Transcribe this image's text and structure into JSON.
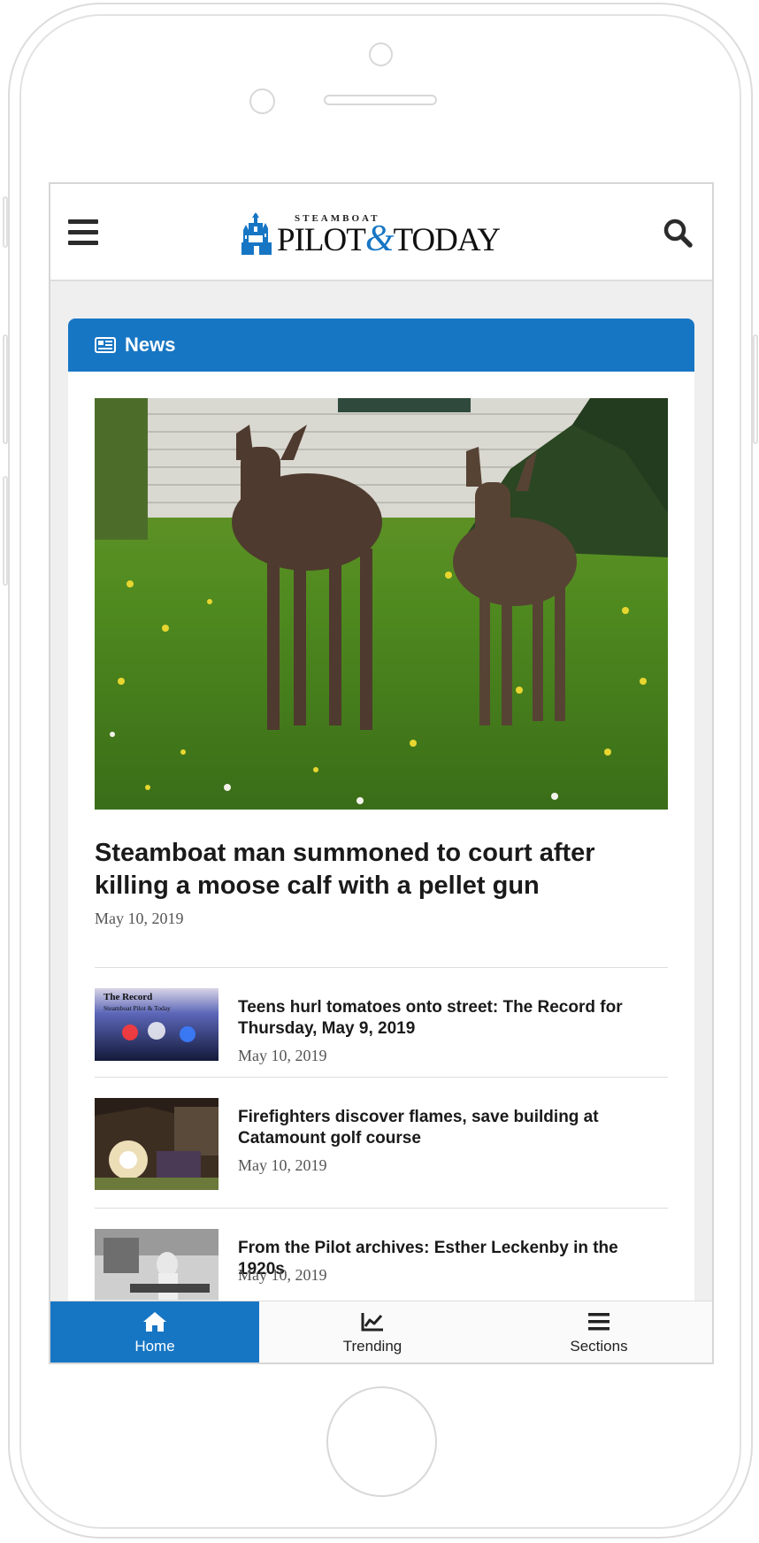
{
  "header": {
    "logo_small": "STEAMBOAT",
    "logo_main_left": "PILOT",
    "logo_amp": "&",
    "logo_main_right": "TODAY"
  },
  "section": {
    "title": "News"
  },
  "lead_story": {
    "title": "Steamboat man summoned to court after killing a moose calf with a pellet gun",
    "date": "May 10, 2019"
  },
  "stories": [
    {
      "title": "Teens hurl tomatoes onto street: The Record for Thursday, May 9, 2019",
      "date": "May 10, 2019",
      "thumb_caption_1": "The Record",
      "thumb_caption_2": "Steamboat Pilot & Today"
    },
    {
      "title": "Firefighters discover flames, save building at Catamount golf course",
      "date": "May 10, 2019"
    },
    {
      "title": "From the Pilot archives: Esther Leckenby in the 1920s",
      "date": "May 10, 2019"
    }
  ],
  "bottom_nav": {
    "home": "Home",
    "trending": "Trending",
    "sections": "Sections"
  },
  "colors": {
    "brand_blue": "#1776c4"
  }
}
